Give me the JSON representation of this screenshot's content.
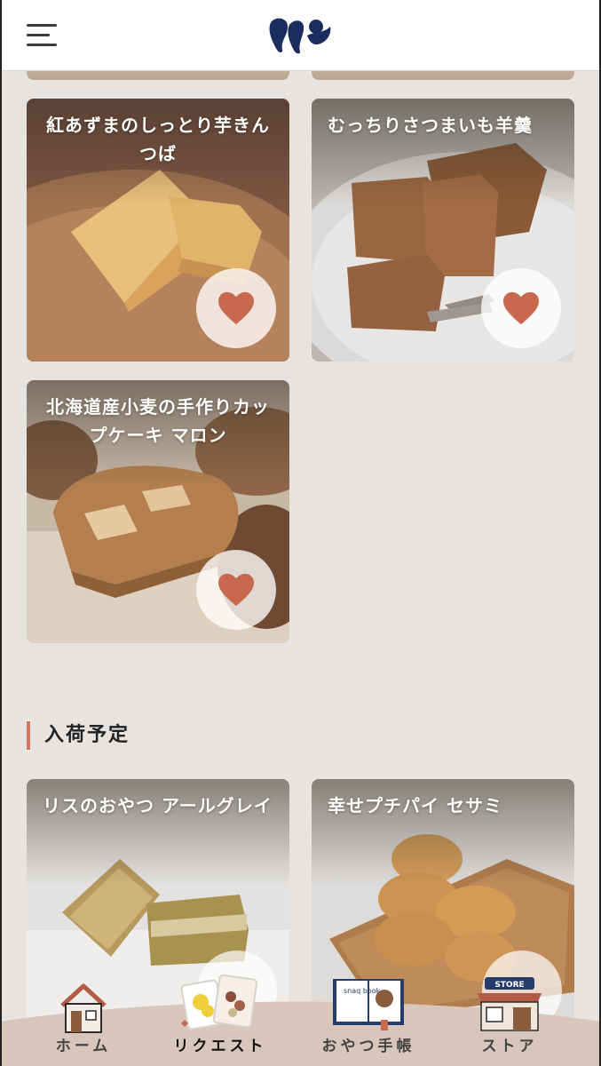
{
  "header": {
    "menu_icon": "hamburger-menu-icon",
    "logo_icon": "brand-logo-icon"
  },
  "products": [
    {
      "title": "紅あずまのしっとり芋きんつば",
      "favorite_icon": "heart-icon"
    },
    {
      "title": "むっちりさつまいも羊羹",
      "favorite_icon": "heart-icon"
    },
    {
      "title": "北海道産小麦の手作りカップケーキ マロン",
      "favorite_icon": "heart-icon"
    }
  ],
  "upcoming": {
    "section_title": "入荷予定",
    "items": [
      {
        "title": "リスのおやつ アールグレイ"
      },
      {
        "title": "幸せプチパイ セサミ"
      }
    ]
  },
  "bottom_nav": {
    "items": [
      {
        "label": "ホーム",
        "icon": "house-icon"
      },
      {
        "label": "リクエスト",
        "icon": "request-cards-icon"
      },
      {
        "label": "おやつ手帳",
        "icon": "snack-book-icon",
        "icon_text": "snaq book"
      },
      {
        "label": "ストア",
        "icon": "store-icon",
        "icon_text": "STORE"
      }
    ],
    "active": "リクエスト"
  },
  "colors": {
    "accent": "#d0775a",
    "heart": "#c8694e",
    "brand_navy": "#1b2d5e",
    "background": "#e6e3e0"
  }
}
